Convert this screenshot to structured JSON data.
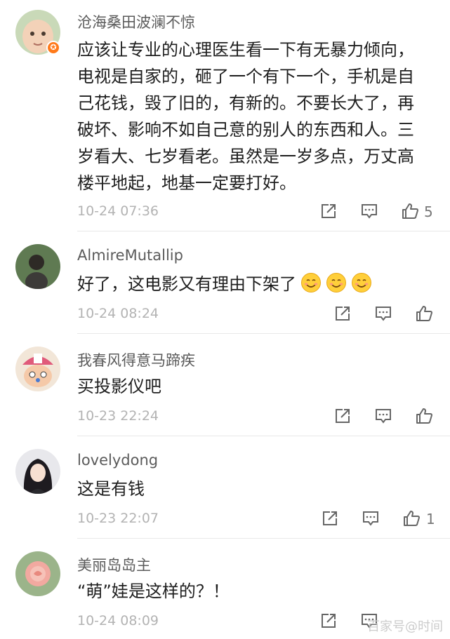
{
  "comments": [
    {
      "username": "沧海桑田波澜不惊",
      "text": "应该让专业的心理医生看一下有无暴力倾向，电视是自家的，砸了一个有下一个，手机是自己花钱，毁了旧的，有新的。不要长大了，再破坏、影响不如自己意的别人的东西和人。三岁看大、七岁看老。虽然是一岁多点，万丈高楼平地起，地基一定要打好。",
      "time": "10-24 07:36",
      "likes": "5",
      "badge": "✪"
    },
    {
      "username": "AlmireMutallip",
      "text": "好了，这电影又有理由下架了",
      "time": "10-24 08:24",
      "likes": ""
    },
    {
      "username": "我春风得意马蹄疾",
      "text": "买投影仪吧",
      "time": "10-23 22:24",
      "likes": ""
    },
    {
      "username": "lovelydong",
      "text": "这是有钱",
      "time": "10-23 22:07",
      "likes": "1"
    },
    {
      "username": "美丽岛岛主",
      "text": "“萌”娃是这样的？！",
      "time": "10-24 08:09",
      "likes": ""
    }
  ],
  "icons": {
    "share": "share-icon",
    "reply": "comment-icon",
    "like": "thumbs-up-icon",
    "emoji": "smiling-face-icon"
  },
  "colors": {
    "badge": "#ff7a1a",
    "time": "#b3b3b3",
    "username": "#5b5b5b"
  },
  "watermark": "百家号@时间"
}
